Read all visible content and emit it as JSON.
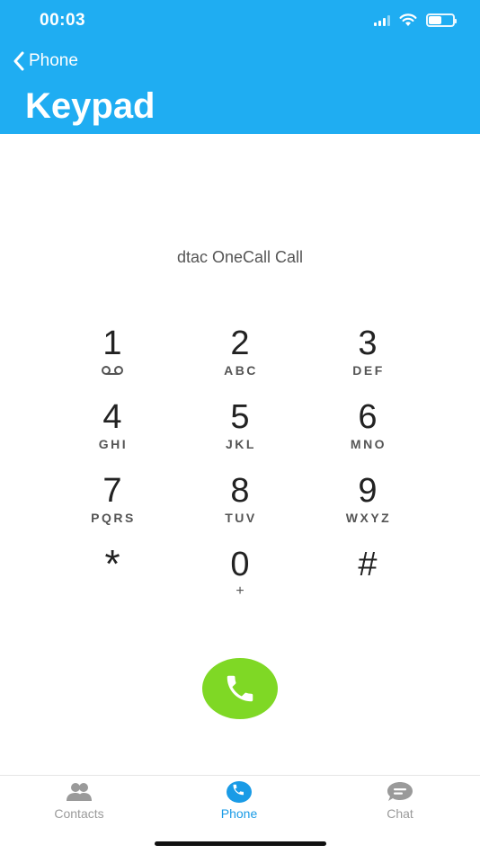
{
  "status_bar": {
    "time": "00:03",
    "battery_level": 0.55
  },
  "header": {
    "back_label": "Phone",
    "title": "Keypad"
  },
  "call_label": "dtac OneCall Call",
  "keypad": [
    {
      "digit": "1",
      "letters": "",
      "sub_icon": "voicemail-icon"
    },
    {
      "digit": "2",
      "letters": "ABC"
    },
    {
      "digit": "3",
      "letters": "DEF"
    },
    {
      "digit": "4",
      "letters": "GHI"
    },
    {
      "digit": "5",
      "letters": "JKL"
    },
    {
      "digit": "6",
      "letters": "MNO"
    },
    {
      "digit": "7",
      "letters": "PQRS"
    },
    {
      "digit": "8",
      "letters": "TUV"
    },
    {
      "digit": "9",
      "letters": "WXYZ"
    },
    {
      "digit": "*",
      "letters": ""
    },
    {
      "digit": "0",
      "letters": "+"
    },
    {
      "digit": "#",
      "letters": ""
    }
  ],
  "tabs": [
    {
      "label": "Contacts",
      "icon": "contacts-icon",
      "active": false
    },
    {
      "label": "Phone",
      "icon": "phone-icon",
      "active": true
    },
    {
      "label": "Chat",
      "icon": "chat-icon",
      "active": false
    }
  ],
  "colors": {
    "header_bg": "#1fadf2",
    "call_button": "#7fd825",
    "active_tab": "#1a9be6",
    "inactive_tab": "#9a9a9a"
  }
}
